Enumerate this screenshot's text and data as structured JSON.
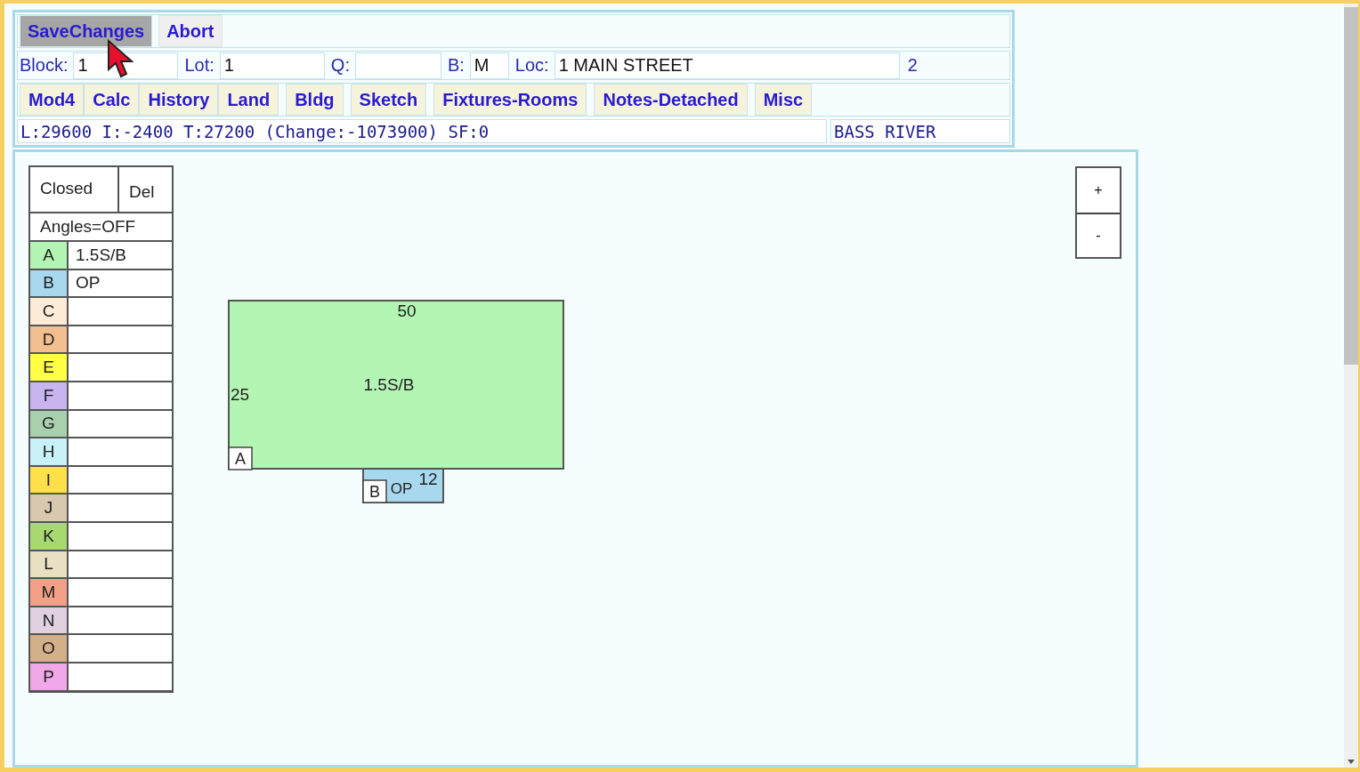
{
  "toolbar": {
    "buttons": [
      {
        "label": "SaveChanges",
        "hovered": true
      },
      {
        "label": "Abort",
        "hovered": false
      }
    ]
  },
  "fields": [
    {
      "label": "Block:",
      "value": "1"
    },
    {
      "label": "Lot:",
      "value": "1"
    },
    {
      "label": "Q:"
    },
    {
      "label": "B:",
      "value": "M"
    },
    {
      "label": "Loc:",
      "value": "1 MAIN STREET"
    }
  ],
  "card_number": "2",
  "tabs": [
    "Mod4",
    "Calc",
    "History",
    "Land",
    "Bldg",
    "Sketch",
    "Fixtures-Rooms",
    "Notes-Detached",
    "Misc"
  ],
  "status": {
    "values": "L:29600 I:-2400 T:27200 (Change:-1073900) SF:0",
    "town": "BASS RIVER"
  },
  "sketch": {
    "closed_button": "Closed",
    "delete_button": "Del",
    "angles_button": "Angles=OFF",
    "areas": [
      {
        "letter": "A",
        "color": "#b3f5b3",
        "name": "1.5S/B"
      },
      {
        "letter": "B",
        "color": "#a8d8ee",
        "name": "OP"
      },
      {
        "letter": "C",
        "color": "#fdebd8"
      },
      {
        "letter": "D",
        "color": "#f3bf90"
      },
      {
        "letter": "E",
        "color": "#ffff44"
      },
      {
        "letter": "F",
        "color": "#c8b4ee"
      },
      {
        "letter": "G",
        "color": "#a8cfae"
      },
      {
        "letter": "H",
        "color": "#c8f2f8"
      },
      {
        "letter": "I",
        "color": "#ffe04a"
      },
      {
        "letter": "J",
        "color": "#d8c8b0"
      },
      {
        "letter": "K",
        "color": "#a8d870"
      },
      {
        "letter": "L",
        "color": "#e8e0c0"
      },
      {
        "letter": "M",
        "color": "#f4a088"
      },
      {
        "letter": "N",
        "color": "#e0d0e0"
      },
      {
        "letter": "O",
        "color": "#d4b088"
      },
      {
        "letter": "P",
        "color": "#f0a8e8"
      }
    ],
    "shapes": [
      {
        "tag": "A",
        "label": "1.5S/B",
        "width_label": "50",
        "depth_label": "25"
      },
      {
        "tag": "B",
        "label": "OP",
        "width_label": "12"
      }
    ],
    "zoom_buttons": [
      "+",
      "-"
    ]
  }
}
